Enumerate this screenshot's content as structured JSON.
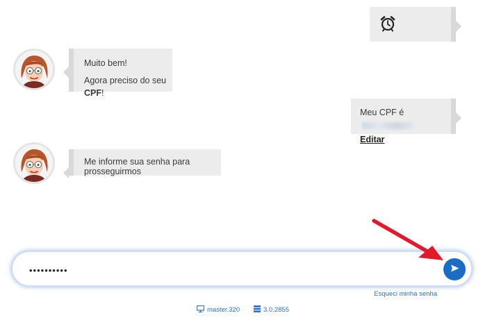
{
  "messages": {
    "alarm_bubble": {
      "icon": "alarm-clock-icon"
    },
    "bot1": {
      "line1": "Muito bem!",
      "line2_prefix": "Agora preciso do seu ",
      "line2_bold": "CPF",
      "line2_suffix": "!"
    },
    "user_cpf": {
      "prefix": "Meu CPF é",
      "edit_label": "Editar"
    },
    "bot2": {
      "text": "Me informe sua senha para prosseguirmos"
    }
  },
  "input": {
    "value": "••••••••••"
  },
  "send": {
    "icon": "send-icon"
  },
  "forgot_password": "Esqueci minha senha",
  "footer": {
    "branch": "master.320",
    "version": "3.0.2855"
  },
  "colors": {
    "accent": "#1a6cc4",
    "bubble": "#ececec",
    "link": "#2a72c5",
    "arrow": "#e3182b"
  }
}
